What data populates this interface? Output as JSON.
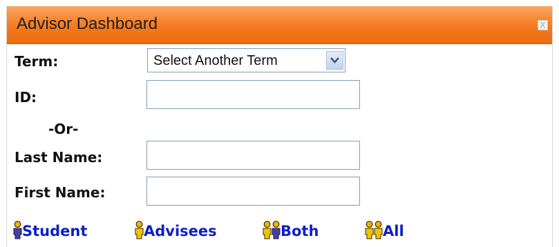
{
  "window": {
    "title": "Advisor Dashboard",
    "close_label": "X"
  },
  "form": {
    "term_label": "Term:",
    "term_selected": "Select Another Term",
    "id_label": "ID:",
    "id_value": "",
    "or_text": "-Or-",
    "last_name_label": "Last Name:",
    "last_name_value": "",
    "first_name_label": "First Name:",
    "first_name_value": ""
  },
  "links": [
    {
      "label": "Student",
      "icon": "single-person-icon",
      "color": "#0b1fc8"
    },
    {
      "label": "Advisees",
      "icon": "single-person-icon",
      "color": "#0b1fc8"
    },
    {
      "label": "Both",
      "icon": "two-people-icon",
      "color": "#0b1fc8"
    },
    {
      "label": "All",
      "icon": "two-people-icon",
      "color": "#0b1fc8"
    }
  ],
  "colors": {
    "titlebar_orange": "#f47a1f",
    "link_blue": "#0b1fc8",
    "input_border": "#7f9db9"
  }
}
